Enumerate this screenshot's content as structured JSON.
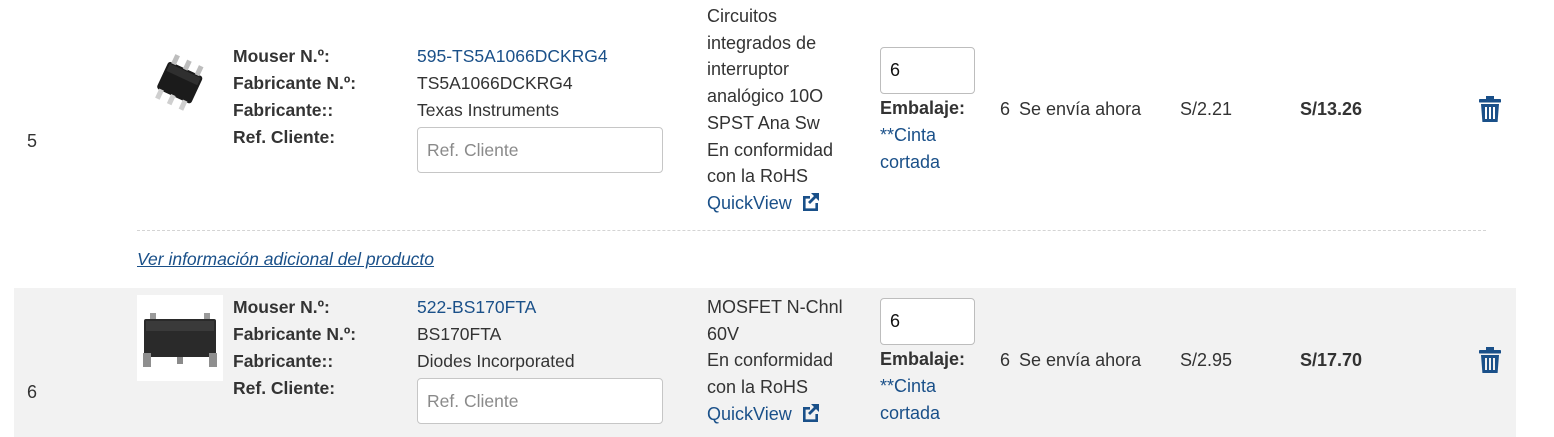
{
  "labels": {
    "mouser_no": "Mouser N.º:",
    "manufacturer_no": "Fabricante N.º:",
    "manufacturer": "Fabricante::",
    "customer_ref": "Ref. Cliente:",
    "packaging": "Embalaje:",
    "quickview": "QuickView",
    "customer_ref_placeholder": "Ref. Cliente"
  },
  "items": [
    {
      "line": "5",
      "mouser_no": "595-TS5A1066DCKRG4",
      "manufacturer_no": "TS5A1066DCKRG4",
      "manufacturer": "Texas Instruments",
      "description_lines": [
        "Circuitos",
        "integrados de",
        "interruptor",
        "analógico 10O",
        "SPST Ana Sw",
        "En conformidad",
        "con la RoHS"
      ],
      "quantity": "6",
      "packaging_line1": "**Cinta",
      "packaging_line2": "cortada",
      "avail_qty": "6",
      "avail_text": "Se envía ahora",
      "unit_price": "S/2.21",
      "ext_price": "S/13.26"
    },
    {
      "line": "6",
      "mouser_no": "522-BS170FTA",
      "manufacturer_no": "BS170FTA",
      "manufacturer": "Diodes Incorporated",
      "description_lines": [
        "MOSFET N-Chnl",
        "60V",
        "En conformidad",
        "con la RoHS"
      ],
      "quantity": "6",
      "packaging_line1": "**Cinta",
      "packaging_line2": "cortada",
      "avail_qty": "6",
      "avail_text": "Se envía ahora",
      "unit_price": "S/2.95",
      "ext_price": "S/17.70"
    }
  ],
  "more_info_link": "Ver información adicional del producto",
  "colors": {
    "link": "#1a5089",
    "row_alt_bg": "#f2f2f2",
    "trash": "#1a5089"
  },
  "icons": [
    "external-link-icon",
    "trash-icon"
  ]
}
